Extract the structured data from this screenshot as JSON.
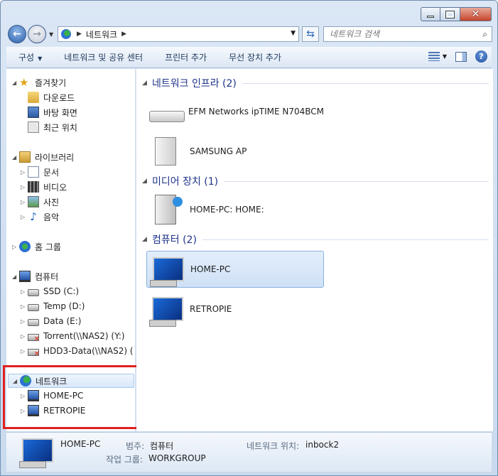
{
  "address": {
    "segments": [
      "네트워크"
    ]
  },
  "search": {
    "placeholder": "네트워크 검색"
  },
  "commands": {
    "organize": "구성",
    "network_center": "네트워크 및 공유 센터",
    "add_printer": "프린터 추가",
    "add_wireless": "무선 장치 추가"
  },
  "nav": {
    "favorites": {
      "label": "즐겨찾기",
      "items": [
        "다운로드",
        "바탕 화면",
        "최근 위치"
      ]
    },
    "libraries": {
      "label": "라이브러리",
      "items": [
        "문서",
        "비디오",
        "사진",
        "음악"
      ]
    },
    "homegroup": {
      "label": "홈 그룹"
    },
    "computer": {
      "label": "컴퓨터",
      "items": [
        "SSD (C:)",
        "Temp (D:)",
        "Data (E:)",
        "Torrent(\\\\NAS2) (Y:)",
        "HDD3-Data(\\\\NAS2) ("
      ]
    },
    "network": {
      "label": "네트워크",
      "items": [
        "HOME-PC",
        "RETROPIE"
      ]
    }
  },
  "groups": [
    {
      "title": "네트워크 인프라 (2)",
      "items": [
        "EFM Networks ipTIME N704BCM",
        "SAMSUNG AP"
      ]
    },
    {
      "title": "미디어 장치 (1)",
      "items": [
        "HOME-PC: HOME:"
      ]
    },
    {
      "title": "컴퓨터 (2)",
      "items": [
        "HOME-PC",
        "RETROPIE"
      ]
    }
  ],
  "details": {
    "name": "HOME-PC",
    "category_label": "범주:",
    "category_value": "컴퓨터",
    "workgroup_label": "작업 그룹:",
    "workgroup_value": "WORKGROUP",
    "location_label": "네트워크 위치:",
    "location_value": "inbock2"
  }
}
